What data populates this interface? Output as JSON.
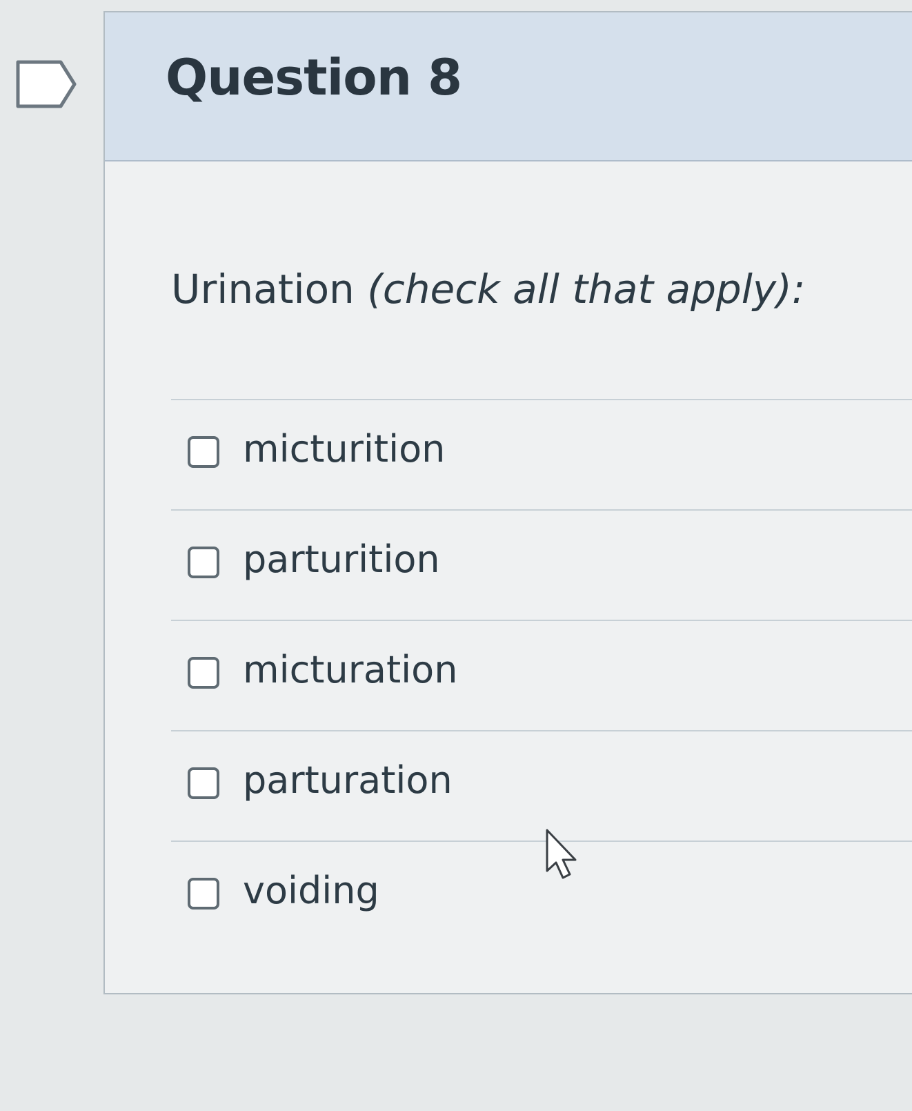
{
  "question": {
    "title": "Question 8",
    "prompt_lead": "Urination ",
    "prompt_hint": "(check all that apply):",
    "answers": [
      {
        "label": "micturition",
        "checked": false
      },
      {
        "label": "parturition",
        "checked": false
      },
      {
        "label": "micturation",
        "checked": false
      },
      {
        "label": "parturation",
        "checked": false
      },
      {
        "label": "voiding",
        "checked": false
      }
    ]
  },
  "icons": {
    "flag": "flag-icon",
    "cursor": "mouse-pointer-icon"
  },
  "colors": {
    "header_bg": "#d5e0ec",
    "card_bg": "#eff1f2",
    "text": "#2d3b45",
    "checkbox_border": "#5f6b73"
  }
}
